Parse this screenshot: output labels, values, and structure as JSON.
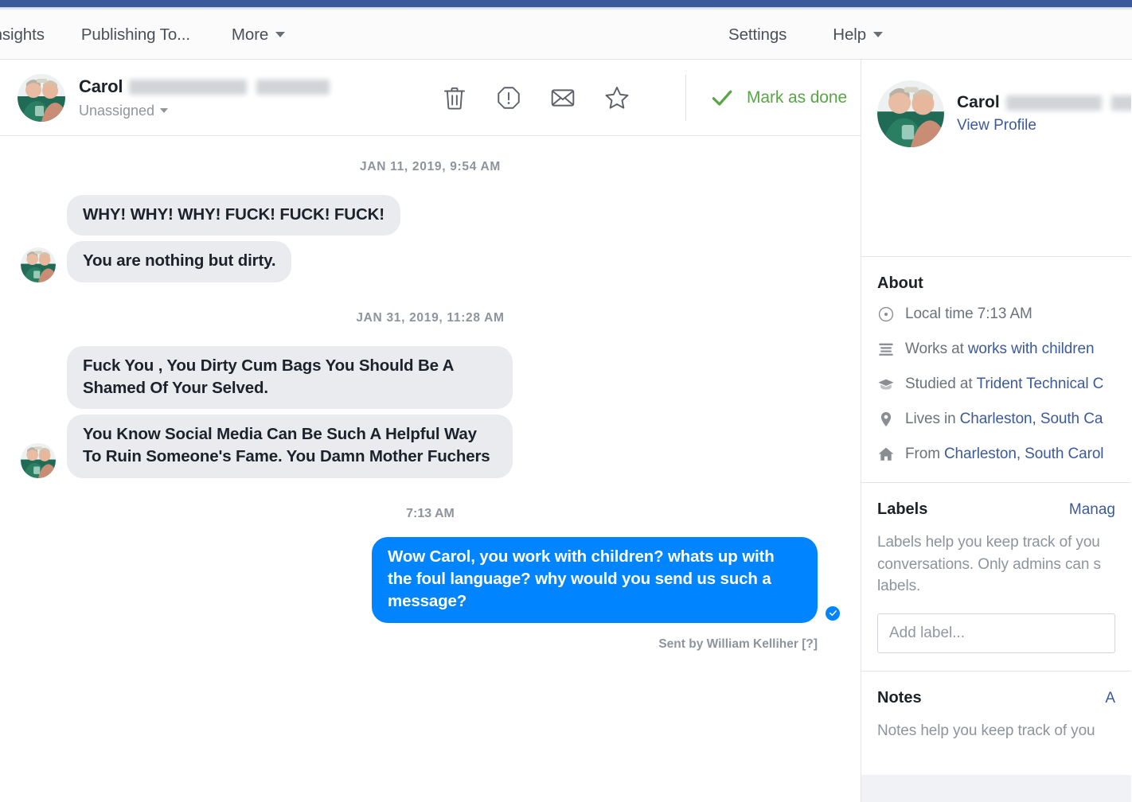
{
  "chrome": {
    "brand_color": "#3b5a9b"
  },
  "nav": {
    "left_items": [
      {
        "label": "Insights",
        "icon": "",
        "has_caret": false
      },
      {
        "label": "Publishing To...",
        "icon": "",
        "has_caret": false
      },
      {
        "label": "More",
        "icon": "chevron-down-icon",
        "has_caret": true
      }
    ],
    "right_items": [
      {
        "label": "Settings",
        "has_caret": false
      },
      {
        "label": "Help",
        "has_caret": true
      }
    ]
  },
  "conversation_header": {
    "contact_first_name": "Carol",
    "contact_last_name_redacted": true,
    "assignee": "Unassigned",
    "actions": [
      {
        "name": "delete-icon",
        "tooltip": "Delete"
      },
      {
        "name": "spam-icon",
        "tooltip": "Mark as spam"
      },
      {
        "name": "mark-unread-icon",
        "tooltip": "Mark as unread"
      },
      {
        "name": "star-icon",
        "tooltip": "Follow up"
      }
    ],
    "mark_as_done_label": "Mark as done",
    "mark_as_done_color": "#59a646",
    "check_icon": "check-icon"
  },
  "thread": {
    "groups": [
      {
        "type": "stamp",
        "text": "JAN 11, 2019, 9:54 AM"
      },
      {
        "type": "incoming",
        "avatar": "contact-avatar",
        "messages": [
          "WHY! WHY! WHY! FUCK! FUCK! FUCK!",
          "You are nothing but dirty."
        ]
      },
      {
        "type": "stamp",
        "text": "JAN 31, 2019, 11:28 AM"
      },
      {
        "type": "incoming",
        "avatar": "contact-avatar",
        "messages": [
          "Fuck You , You Dirty Cum Bags You Should Be A Shamed Of Your Selved.",
          "You Know Social Media Can Be Such A Helpful Way To Ruin Someone's Fame. You Damn Mother Fuchers"
        ]
      },
      {
        "type": "stamp",
        "text": "7:13 AM"
      },
      {
        "type": "outgoing",
        "messages": [
          "Wow Carol, you work with children? whats up with the foul language? why would you send us such a message?"
        ],
        "delivery_icon": "delivered-check-icon",
        "sent_by": "Sent by William Kelliher [?]"
      }
    ],
    "bubble_colors": {
      "incoming": "#e9ebee",
      "outgoing": "#0084ff"
    }
  },
  "profile_pane": {
    "identity": {
      "name": "Carol",
      "name_redacted": true,
      "view_profile_label": "View Profile",
      "avatar": "contact-avatar"
    },
    "about": {
      "title": "About",
      "rows": [
        {
          "icon": "clock-icon",
          "prefix": "Local time 7:13 AM",
          "link": ""
        },
        {
          "icon": "briefcase-icon",
          "prefix": "Works at",
          "link": "works with children"
        },
        {
          "icon": "graduation-cap-icon",
          "prefix": "Studied at",
          "link": "Trident Technical C"
        },
        {
          "icon": "location-pin-icon",
          "prefix": "Lives in",
          "link": "Charleston, South Ca"
        },
        {
          "icon": "home-icon",
          "prefix": "From",
          "link": "Charleston, South Carol"
        }
      ]
    },
    "labels": {
      "title": "Labels",
      "manage_link": "Manag",
      "helper": "Labels help you keep track of you conversations. Only admins can s labels.",
      "input_placeholder": "Add label..."
    },
    "notes": {
      "title": "Notes",
      "add_link": "A",
      "helper": "Notes help you keep track of you"
    }
  }
}
